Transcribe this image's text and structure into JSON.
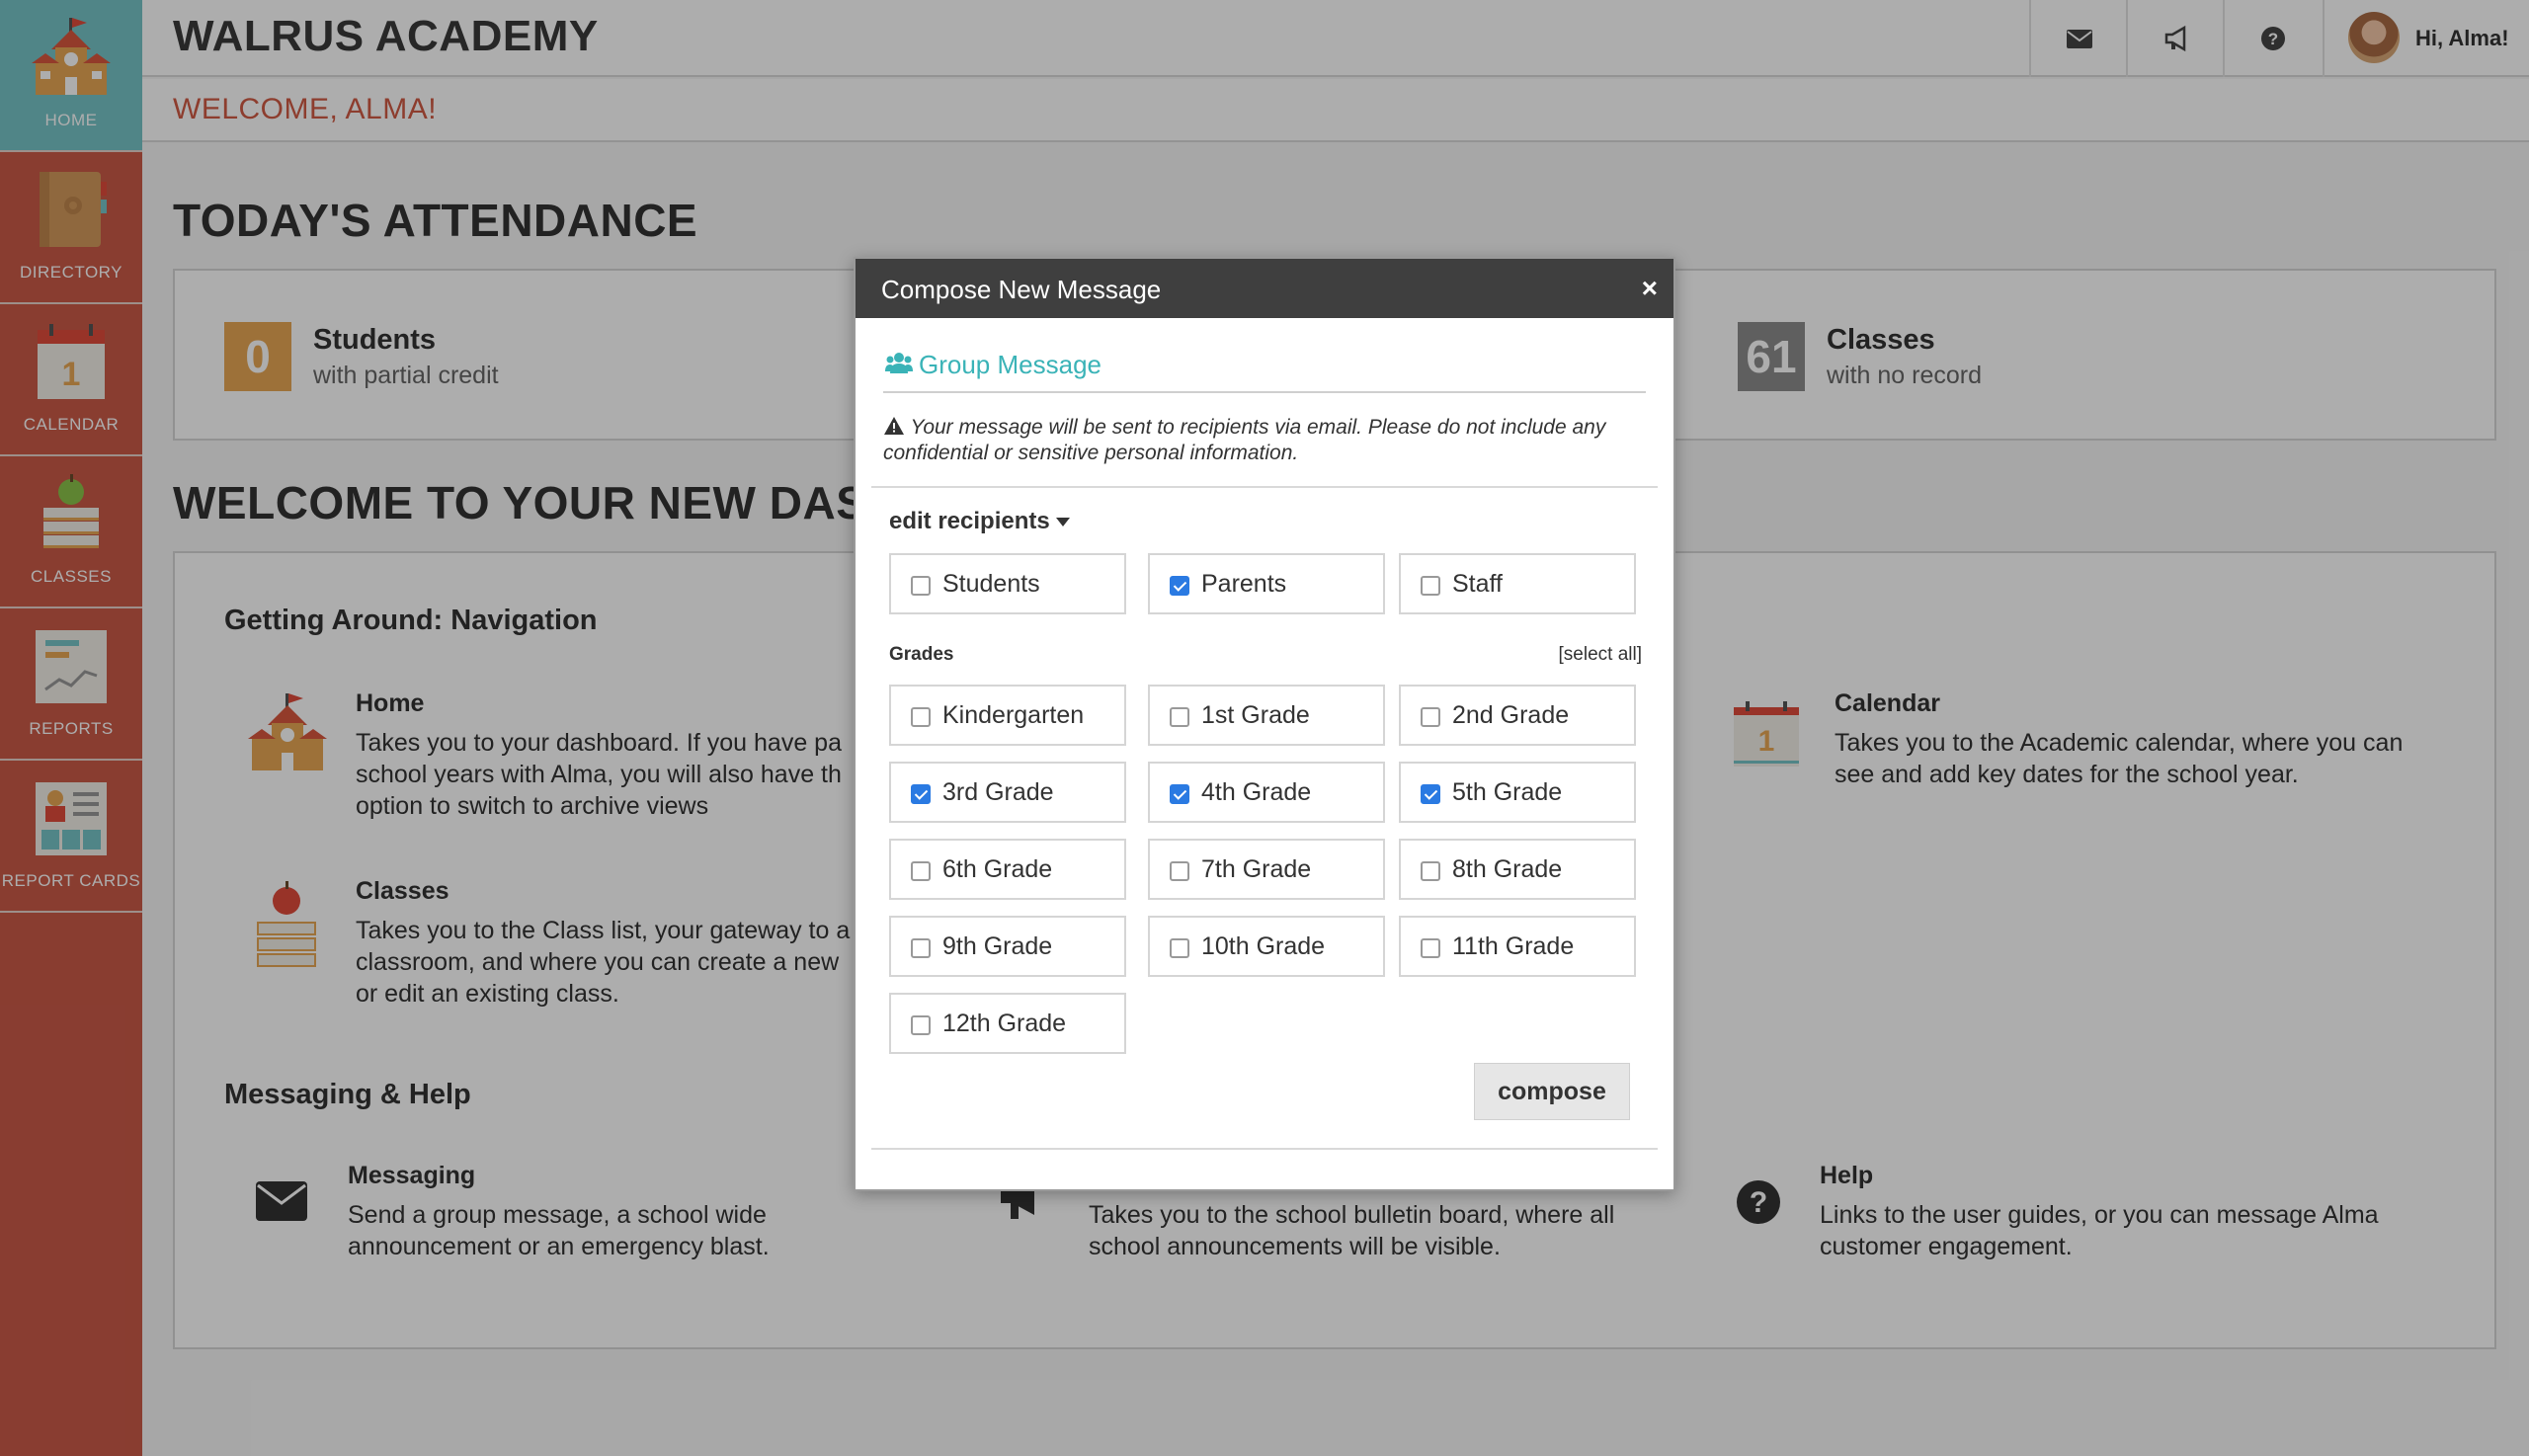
{
  "sidebar": {
    "items": [
      {
        "label": "HOME",
        "icon": "school-house-icon"
      },
      {
        "label": "DIRECTORY",
        "icon": "address-book-icon"
      },
      {
        "label": "CALENDAR",
        "icon": "calendar-icon"
      },
      {
        "label": "CLASSES",
        "icon": "books-apple-icon"
      },
      {
        "label": "REPORTS",
        "icon": "report-chart-icon"
      },
      {
        "label": "REPORT CARDS",
        "icon": "report-card-icon"
      }
    ]
  },
  "header": {
    "school_name": "WALRUS ACADEMY",
    "greeting": "Hi, Alma!",
    "welcome": "WELCOME, ALMA!"
  },
  "attendance": {
    "title": "TODAY'S ATTENDANCE",
    "stats": [
      {
        "value": "0",
        "label": "Students",
        "sub": "with partial credit",
        "color": "#e8a755"
      },
      {
        "value": "61",
        "label": "Classes",
        "sub": "with no record",
        "color": "#8c8c8c"
      }
    ]
  },
  "dashboard": {
    "title": "WELCOME TO YOUR NEW DASH",
    "nav_heading": "Getting Around: Navigation",
    "home": {
      "title": "Home",
      "desc1": "Takes you to your dashboard. If you have pa",
      "desc2": "school years with Alma, you will also have th",
      "desc3": "option to switch to archive views"
    },
    "classes": {
      "title": "Classes",
      "desc1": "Takes you to the Class list, your gateway to a",
      "desc2": "classroom, and where you can create a new",
      "desc3": "or edit an existing class."
    },
    "calendar": {
      "title": "Calendar",
      "desc1": "Takes you to the Academic calendar, where you can",
      "desc2": "see and add key dates for the school year."
    },
    "msg_heading": "Messaging & Help",
    "messaging": {
      "title": "Messaging",
      "desc1": "Send a group message, a school wide",
      "desc2": "announcement or an emergency blast."
    },
    "bulletin": {
      "desc1": "Takes you to the school bulletin board, where all",
      "desc2": "school announcements will be visible."
    },
    "help": {
      "title": "Help",
      "desc1": "Links to the user guides, or you can message Alma",
      "desc2": "customer engagement."
    }
  },
  "modal": {
    "title": "Compose New Message",
    "close": "×",
    "group_label": "Group Message",
    "warning": "Your message will be sent to recipients via email. Please do not include any confidential or sensitive personal information.",
    "edit_recipients": "edit recipients",
    "recipients": [
      {
        "label": "Students",
        "checked": false
      },
      {
        "label": "Parents",
        "checked": true
      },
      {
        "label": "Staff",
        "checked": false
      }
    ],
    "grades_label": "Grades",
    "select_all": "[select all]",
    "grades": [
      {
        "label": "Kindergarten",
        "checked": false
      },
      {
        "label": "1st Grade",
        "checked": false
      },
      {
        "label": "2nd Grade",
        "checked": false
      },
      {
        "label": "3rd Grade",
        "checked": true
      },
      {
        "label": "4th Grade",
        "checked": true
      },
      {
        "label": "5th Grade",
        "checked": true
      },
      {
        "label": "6th Grade",
        "checked": false
      },
      {
        "label": "7th Grade",
        "checked": false
      },
      {
        "label": "8th Grade",
        "checked": false
      },
      {
        "label": "9th Grade",
        "checked": false
      },
      {
        "label": "10th Grade",
        "checked": false
      },
      {
        "label": "11th Grade",
        "checked": false
      },
      {
        "label": "12th Grade",
        "checked": false
      }
    ],
    "compose_label": "compose"
  }
}
